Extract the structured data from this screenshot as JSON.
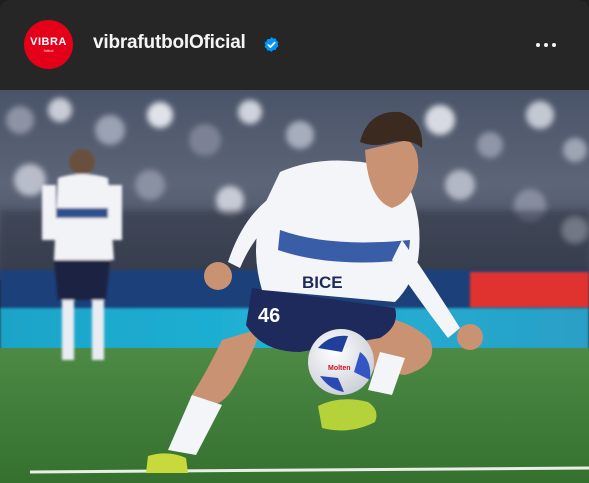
{
  "header": {
    "avatar_word": "VIBRA",
    "avatar_sub": "fútbol",
    "username": "vibrafutbolOficial",
    "verified_icon": "verified-badge-icon",
    "more_icon": "more-horizontal-icon"
  },
  "photo": {
    "shirt_number": "46",
    "sponsor_text": "BICE",
    "ball_brand": "Molten"
  },
  "colors": {
    "header_bg": "#262626",
    "avatar_red": "#e50019",
    "verified_blue": "#0095f6",
    "pitch_green": "#3c7a3a"
  }
}
